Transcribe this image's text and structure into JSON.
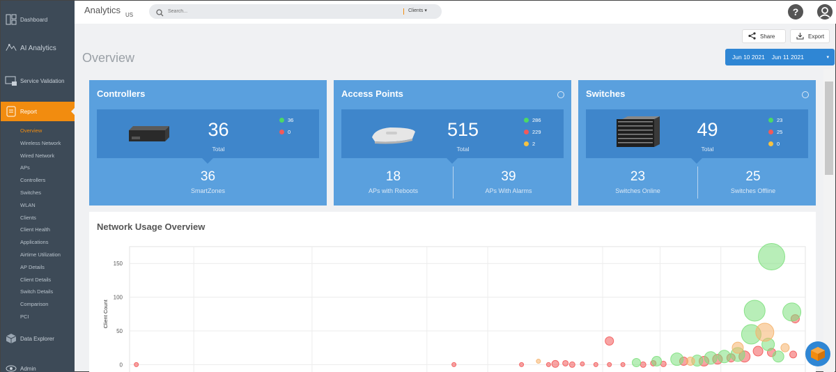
{
  "sidebar": {
    "items": [
      {
        "label": "Dashboard",
        "icon": "dashboard-icon"
      },
      {
        "label": "AI Analytics",
        "icon": "ai-analytics-icon"
      },
      {
        "label": "Service Validation",
        "icon": "service-validation-icon"
      },
      {
        "label": "Report",
        "icon": "report-icon",
        "active": true
      },
      {
        "label": "Data Explorer",
        "icon": "data-explorer-icon"
      },
      {
        "label": "Admin",
        "icon": "admin-icon"
      }
    ],
    "report_subitems": [
      "Overview",
      "Wireless Network",
      "Wired Network",
      "APs",
      "Controllers",
      "Switches",
      "WLAN",
      "Clients",
      "Client Health",
      "Applications",
      "Airtime Utilization",
      "AP Details",
      "Client Details",
      "Switch Details",
      "Comparison",
      "PCI"
    ],
    "selected_subitem": "Overview"
  },
  "header": {
    "app_title": "Analytics",
    "region": "US",
    "search_placeholder": "Search...",
    "search_scope": "Clients"
  },
  "toolbar": {
    "share_label": "Share",
    "export_label": "Export"
  },
  "page": {
    "title": "Overview",
    "date_from": "Jun 10 2021",
    "date_to": "Jun 11 2021"
  },
  "cards": {
    "controllers": {
      "title": "Controllers",
      "total": "36",
      "total_label": "Total",
      "legend": [
        {
          "value": "36",
          "color": "#4cd964"
        },
        {
          "value": "0",
          "color": "#f25a5a"
        }
      ],
      "stats": [
        {
          "value": "36",
          "label": "SmartZones"
        }
      ]
    },
    "access_points": {
      "title": "Access Points",
      "total": "515",
      "total_label": "Total",
      "legend": [
        {
          "value": "286",
          "color": "#4cd964"
        },
        {
          "value": "229",
          "color": "#f25a5a"
        },
        {
          "value": "2",
          "color": "#f5c242"
        }
      ],
      "stats": [
        {
          "value": "18",
          "label": "APs with Reboots"
        },
        {
          "value": "39",
          "label": "APs With Alarms"
        }
      ]
    },
    "switches": {
      "title": "Switches",
      "total": "49",
      "total_label": "Total",
      "legend": [
        {
          "value": "23",
          "color": "#4cd964"
        },
        {
          "value": "25",
          "color": "#f25a5a"
        },
        {
          "value": "0",
          "color": "#f5c242"
        }
      ],
      "stats": [
        {
          "value": "23",
          "label": "Switches Online"
        },
        {
          "value": "25",
          "label": "Switches Offline"
        }
      ]
    }
  },
  "chart_data": {
    "type": "scatter",
    "title": "Network Usage Overview",
    "ylabel": "Client Count",
    "xlabel": "",
    "ylim": [
      -12,
      175
    ],
    "yticks": [
      0,
      50,
      100,
      150
    ],
    "grid": true,
    "series": [
      {
        "color": "#f25a5a",
        "points": [
          {
            "x": 0.01,
            "y": 0,
            "r": 3
          },
          {
            "x": 0.48,
            "y": 0,
            "r": 3
          },
          {
            "x": 0.58,
            "y": 0,
            "r": 3
          },
          {
            "x": 0.62,
            "y": 0,
            "r": 3
          },
          {
            "x": 0.63,
            "y": 1,
            "r": 5
          },
          {
            "x": 0.645,
            "y": 2,
            "r": 4
          },
          {
            "x": 0.655,
            "y": 0,
            "r": 4
          },
          {
            "x": 0.67,
            "y": 1,
            "r": 3
          },
          {
            "x": 0.69,
            "y": 0,
            "r": 3
          },
          {
            "x": 0.71,
            "y": 0,
            "r": 3
          },
          {
            "x": 0.73,
            "y": 0,
            "r": 3
          },
          {
            "x": 0.76,
            "y": 0,
            "r": 4
          },
          {
            "x": 0.775,
            "y": 2,
            "r": 4
          },
          {
            "x": 0.79,
            "y": 1,
            "r": 4
          },
          {
            "x": 0.71,
            "y": 35,
            "r": 6
          },
          {
            "x": 0.82,
            "y": 5,
            "r": 6
          },
          {
            "x": 0.85,
            "y": 5,
            "r": 7
          },
          {
            "x": 0.87,
            "y": 8,
            "r": 7
          },
          {
            "x": 0.89,
            "y": 10,
            "r": 6
          },
          {
            "x": 0.91,
            "y": 12,
            "r": 8
          },
          {
            "x": 0.93,
            "y": 20,
            "r": 7
          },
          {
            "x": 0.95,
            "y": 18,
            "r": 6
          },
          {
            "x": 0.985,
            "y": 68,
            "r": 6
          },
          {
            "x": 0.982,
            "y": 15,
            "r": 5
          }
        ]
      },
      {
        "color": "#7ee07e",
        "points": [
          {
            "x": 0.75,
            "y": 3,
            "r": 6
          },
          {
            "x": 0.78,
            "y": 5,
            "r": 7
          },
          {
            "x": 0.81,
            "y": 8,
            "r": 9
          },
          {
            "x": 0.84,
            "y": 6,
            "r": 8
          },
          {
            "x": 0.86,
            "y": 10,
            "r": 9
          },
          {
            "x": 0.88,
            "y": 12,
            "r": 9
          },
          {
            "x": 0.9,
            "y": 15,
            "r": 10
          },
          {
            "x": 0.92,
            "y": 45,
            "r": 14
          },
          {
            "x": 0.925,
            "y": 80,
            "r": 15
          },
          {
            "x": 0.95,
            "y": 160,
            "r": 19
          },
          {
            "x": 0.98,
            "y": 78,
            "r": 13
          },
          {
            "x": 0.945,
            "y": 30,
            "r": 9
          },
          {
            "x": 0.96,
            "y": 12,
            "r": 8
          }
        ]
      },
      {
        "color": "#f5b36b",
        "points": [
          {
            "x": 0.605,
            "y": 5,
            "r": 3
          },
          {
            "x": 0.83,
            "y": 5,
            "r": 6
          },
          {
            "x": 0.9,
            "y": 25,
            "r": 8
          },
          {
            "x": 0.94,
            "y": 48,
            "r": 13
          },
          {
            "x": 0.97,
            "y": 25,
            "r": 6
          }
        ]
      }
    ]
  }
}
